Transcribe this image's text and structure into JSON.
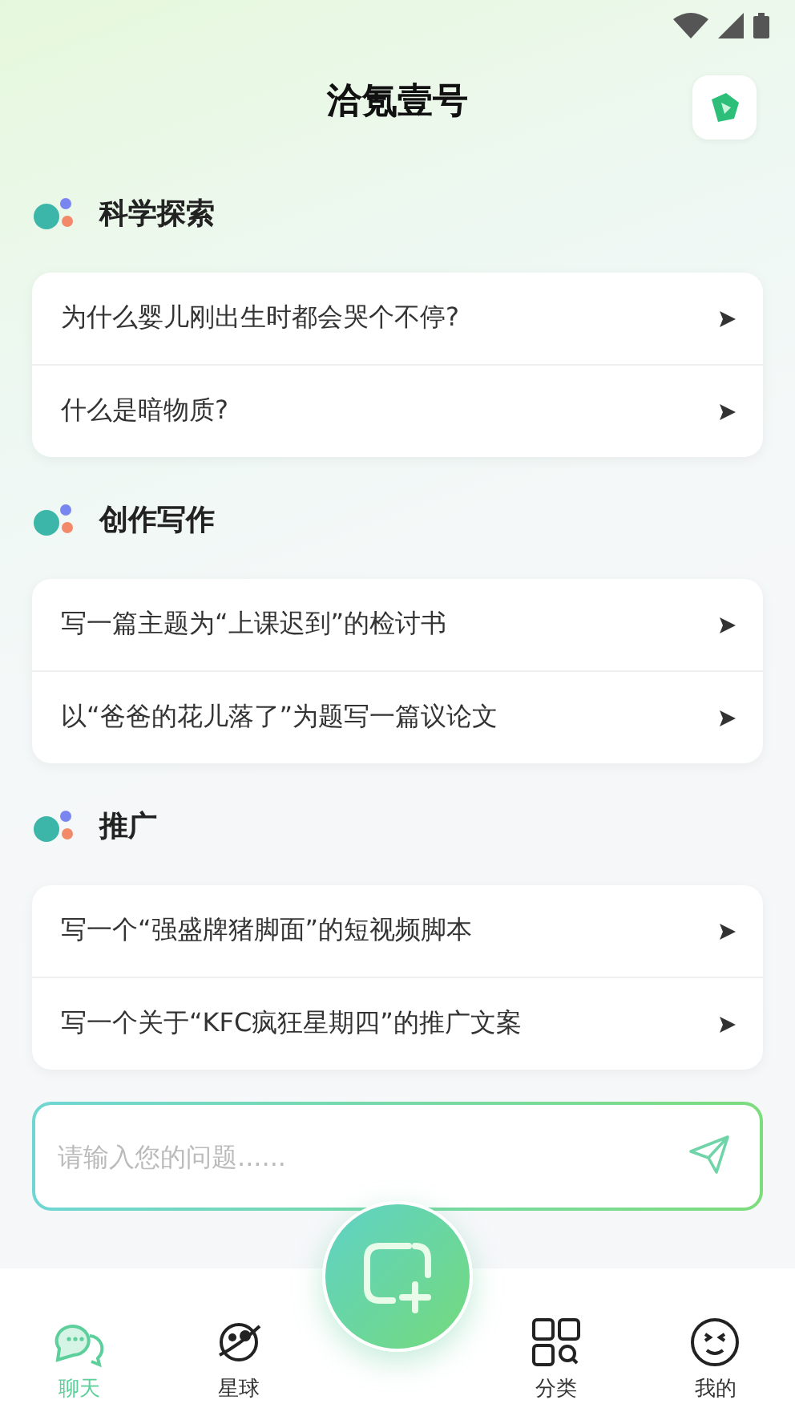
{
  "header": {
    "title": "洽氪壹号"
  },
  "sections": [
    {
      "title": "科学探索",
      "items": [
        "为什么婴儿刚出生时都会哭个不停?",
        "什么是暗物质?"
      ]
    },
    {
      "title": "创作写作",
      "items": [
        "写一篇主题为“上课迟到”的检讨书",
        "以“爸爸的花儿落了”为题写一篇议论文"
      ]
    },
    {
      "title": "推广",
      "items": [
        "写一个“强盛牌猪脚面”的短视频脚本",
        "写一个关于“KFC疯狂星期四”的推广文案"
      ]
    }
  ],
  "input": {
    "placeholder": "请输入您的问题......"
  },
  "nav": [
    {
      "kind": "chat",
      "label": "聊天",
      "selected": true
    },
    {
      "kind": "planet",
      "label": "星球",
      "selected": false
    },
    {
      "kind": "add"
    },
    {
      "kind": "grid",
      "label": "分类",
      "selected": false
    },
    {
      "kind": "face",
      "label": "我的",
      "selected": false
    }
  ]
}
